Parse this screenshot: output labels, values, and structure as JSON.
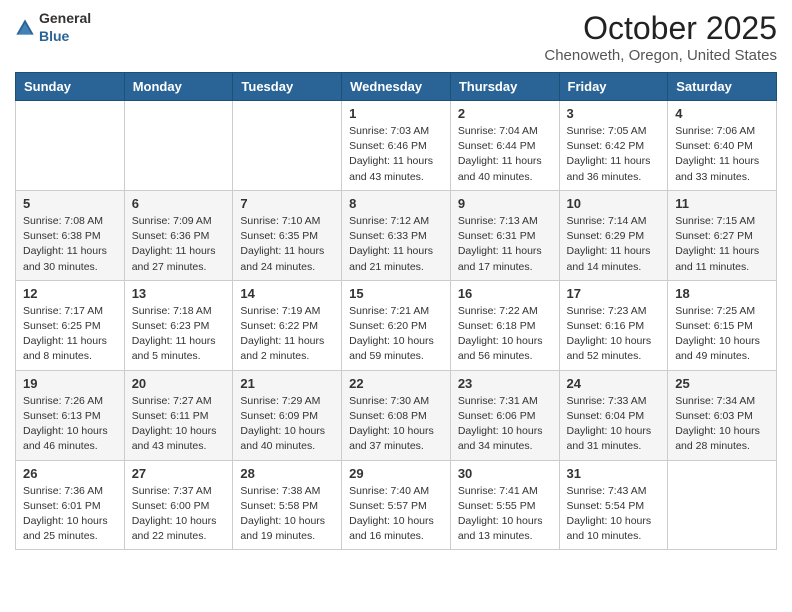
{
  "header": {
    "logo_general": "General",
    "logo_blue": "Blue",
    "month": "October 2025",
    "location": "Chenoweth, Oregon, United States"
  },
  "weekdays": [
    "Sunday",
    "Monday",
    "Tuesday",
    "Wednesday",
    "Thursday",
    "Friday",
    "Saturday"
  ],
  "weeks": [
    [
      {
        "day": "",
        "info": ""
      },
      {
        "day": "",
        "info": ""
      },
      {
        "day": "",
        "info": ""
      },
      {
        "day": "1",
        "info": "Sunrise: 7:03 AM\nSunset: 6:46 PM\nDaylight: 11 hours\nand 43 minutes."
      },
      {
        "day": "2",
        "info": "Sunrise: 7:04 AM\nSunset: 6:44 PM\nDaylight: 11 hours\nand 40 minutes."
      },
      {
        "day": "3",
        "info": "Sunrise: 7:05 AM\nSunset: 6:42 PM\nDaylight: 11 hours\nand 36 minutes."
      },
      {
        "day": "4",
        "info": "Sunrise: 7:06 AM\nSunset: 6:40 PM\nDaylight: 11 hours\nand 33 minutes."
      }
    ],
    [
      {
        "day": "5",
        "info": "Sunrise: 7:08 AM\nSunset: 6:38 PM\nDaylight: 11 hours\nand 30 minutes."
      },
      {
        "day": "6",
        "info": "Sunrise: 7:09 AM\nSunset: 6:36 PM\nDaylight: 11 hours\nand 27 minutes."
      },
      {
        "day": "7",
        "info": "Sunrise: 7:10 AM\nSunset: 6:35 PM\nDaylight: 11 hours\nand 24 minutes."
      },
      {
        "day": "8",
        "info": "Sunrise: 7:12 AM\nSunset: 6:33 PM\nDaylight: 11 hours\nand 21 minutes."
      },
      {
        "day": "9",
        "info": "Sunrise: 7:13 AM\nSunset: 6:31 PM\nDaylight: 11 hours\nand 17 minutes."
      },
      {
        "day": "10",
        "info": "Sunrise: 7:14 AM\nSunset: 6:29 PM\nDaylight: 11 hours\nand 14 minutes."
      },
      {
        "day": "11",
        "info": "Sunrise: 7:15 AM\nSunset: 6:27 PM\nDaylight: 11 hours\nand 11 minutes."
      }
    ],
    [
      {
        "day": "12",
        "info": "Sunrise: 7:17 AM\nSunset: 6:25 PM\nDaylight: 11 hours\nand 8 minutes."
      },
      {
        "day": "13",
        "info": "Sunrise: 7:18 AM\nSunset: 6:23 PM\nDaylight: 11 hours\nand 5 minutes."
      },
      {
        "day": "14",
        "info": "Sunrise: 7:19 AM\nSunset: 6:22 PM\nDaylight: 11 hours\nand 2 minutes."
      },
      {
        "day": "15",
        "info": "Sunrise: 7:21 AM\nSunset: 6:20 PM\nDaylight: 10 hours\nand 59 minutes."
      },
      {
        "day": "16",
        "info": "Sunrise: 7:22 AM\nSunset: 6:18 PM\nDaylight: 10 hours\nand 56 minutes."
      },
      {
        "day": "17",
        "info": "Sunrise: 7:23 AM\nSunset: 6:16 PM\nDaylight: 10 hours\nand 52 minutes."
      },
      {
        "day": "18",
        "info": "Sunrise: 7:25 AM\nSunset: 6:15 PM\nDaylight: 10 hours\nand 49 minutes."
      }
    ],
    [
      {
        "day": "19",
        "info": "Sunrise: 7:26 AM\nSunset: 6:13 PM\nDaylight: 10 hours\nand 46 minutes."
      },
      {
        "day": "20",
        "info": "Sunrise: 7:27 AM\nSunset: 6:11 PM\nDaylight: 10 hours\nand 43 minutes."
      },
      {
        "day": "21",
        "info": "Sunrise: 7:29 AM\nSunset: 6:09 PM\nDaylight: 10 hours\nand 40 minutes."
      },
      {
        "day": "22",
        "info": "Sunrise: 7:30 AM\nSunset: 6:08 PM\nDaylight: 10 hours\nand 37 minutes."
      },
      {
        "day": "23",
        "info": "Sunrise: 7:31 AM\nSunset: 6:06 PM\nDaylight: 10 hours\nand 34 minutes."
      },
      {
        "day": "24",
        "info": "Sunrise: 7:33 AM\nSunset: 6:04 PM\nDaylight: 10 hours\nand 31 minutes."
      },
      {
        "day": "25",
        "info": "Sunrise: 7:34 AM\nSunset: 6:03 PM\nDaylight: 10 hours\nand 28 minutes."
      }
    ],
    [
      {
        "day": "26",
        "info": "Sunrise: 7:36 AM\nSunset: 6:01 PM\nDaylight: 10 hours\nand 25 minutes."
      },
      {
        "day": "27",
        "info": "Sunrise: 7:37 AM\nSunset: 6:00 PM\nDaylight: 10 hours\nand 22 minutes."
      },
      {
        "day": "28",
        "info": "Sunrise: 7:38 AM\nSunset: 5:58 PM\nDaylight: 10 hours\nand 19 minutes."
      },
      {
        "day": "29",
        "info": "Sunrise: 7:40 AM\nSunset: 5:57 PM\nDaylight: 10 hours\nand 16 minutes."
      },
      {
        "day": "30",
        "info": "Sunrise: 7:41 AM\nSunset: 5:55 PM\nDaylight: 10 hours\nand 13 minutes."
      },
      {
        "day": "31",
        "info": "Sunrise: 7:43 AM\nSunset: 5:54 PM\nDaylight: 10 hours\nand 10 minutes."
      },
      {
        "day": "",
        "info": ""
      }
    ]
  ]
}
